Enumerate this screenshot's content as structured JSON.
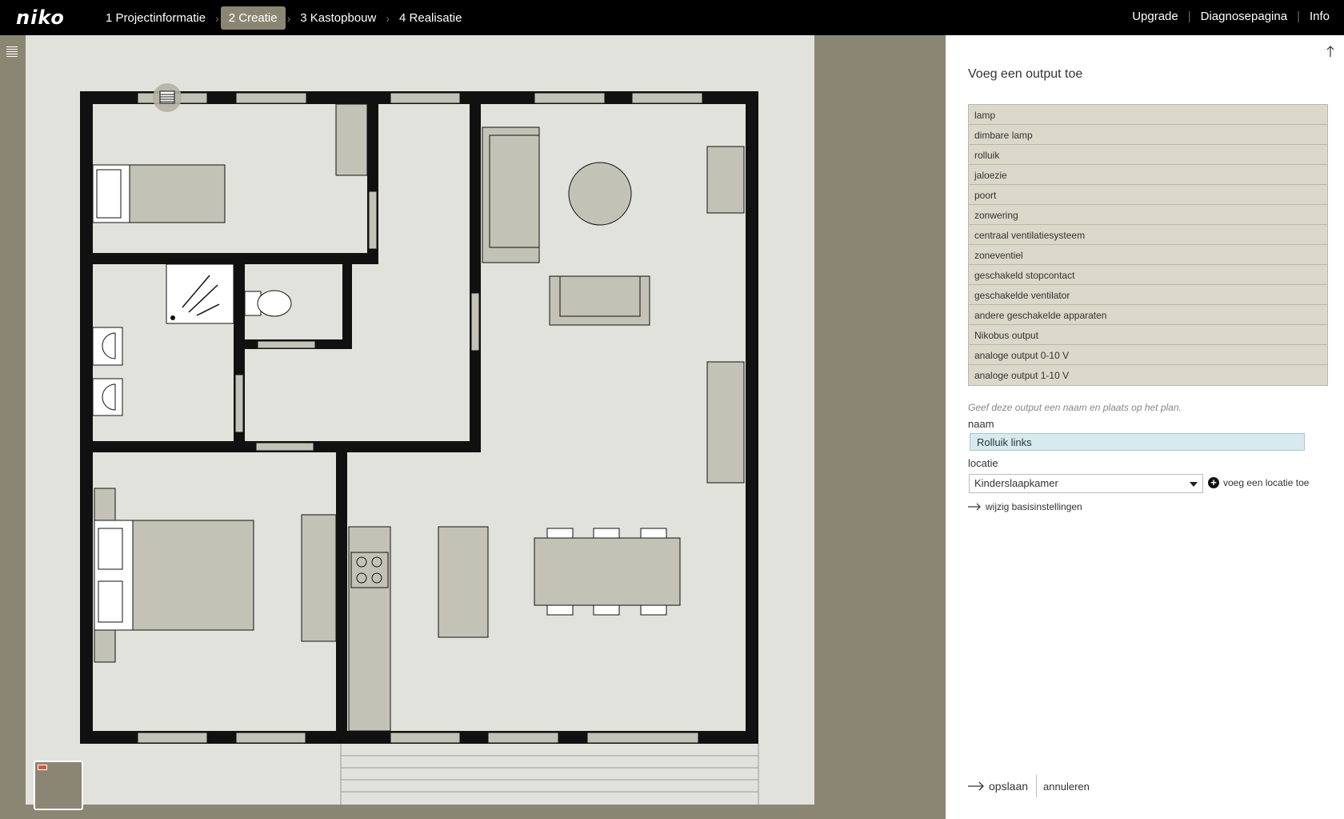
{
  "brand": {
    "logo": "niko"
  },
  "steps": [
    {
      "label": "1 Projectinformatie",
      "active": false
    },
    {
      "label": "2 Creatie",
      "active": true
    },
    {
      "label": "3 Kastopbouw",
      "active": false
    },
    {
      "label": "4 Realisatie",
      "active": false
    }
  ],
  "toplinks": {
    "upgrade": "Upgrade",
    "diagnose": "Diagnosepagina",
    "info": "Info"
  },
  "panel": {
    "title": "Voeg een output toe",
    "outputs": [
      "lamp",
      "dimbare lamp",
      "rolluik",
      "jaloezie",
      "poort",
      "zonwering",
      "centraal ventilatiesysteem",
      "zoneventiel",
      "geschakeld stopcontact",
      "geschakelde ventilator",
      "andere geschakelde apparaten",
      "Nikobus output",
      "analoge output 0-10 V",
      "analoge output 1-10 V"
    ],
    "hint": "Geef deze output een naam en plaats op het plan.",
    "name_label": "naam",
    "name_value": "Rolluik links",
    "location_label": "locatie",
    "location_value": "Kinderslaapkamer",
    "add_location": "voeg een locatie toe",
    "basic_settings": "wijzig basisinstellingen",
    "save": "opslaan",
    "cancel": "annuleren"
  },
  "colors": {
    "topbar": "#000000",
    "accent": "#8a8673",
    "canvas": "#e2e2dc",
    "furniture": "#c3c2b6",
    "wall": "#111111",
    "list_bg": "#d9d8c9",
    "input_bg": "#d6eaf0"
  },
  "icons": [
    "menu-icon",
    "arrow-up-icon",
    "plus-icon",
    "arrow-right-icon",
    "rolluik-icon"
  ]
}
